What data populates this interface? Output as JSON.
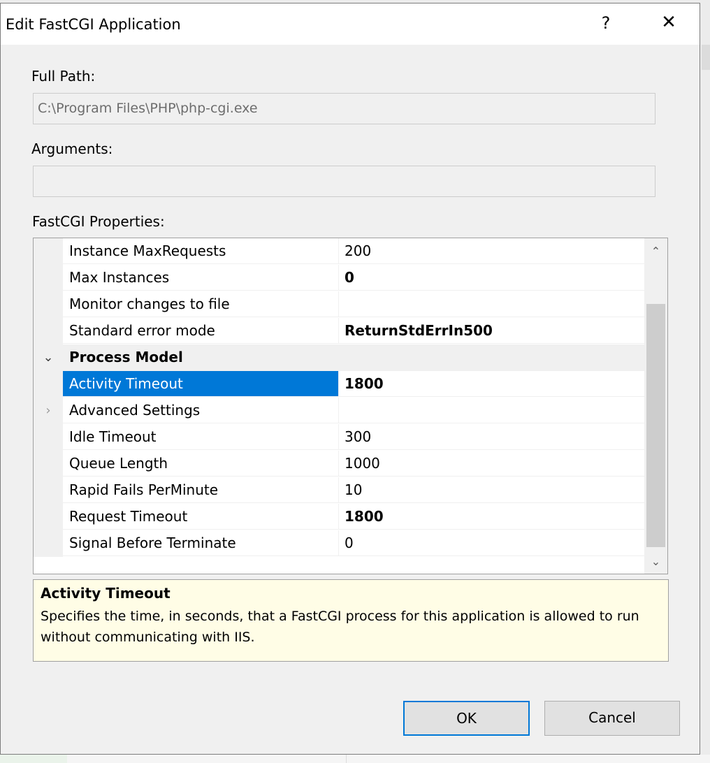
{
  "window": {
    "title": "Edit FastCGI Application",
    "help_glyph": "?",
    "close_glyph": "✕"
  },
  "full_path": {
    "label": "Full Path:",
    "value": "C:\\Program Files\\PHP\\php-cgi.exe"
  },
  "arguments": {
    "label": "Arguments:",
    "value": ""
  },
  "properties": {
    "label": "FastCGI Properties:",
    "rows": [
      {
        "name": "Instance MaxRequests",
        "value": "200",
        "bold": false
      },
      {
        "name": "Max Instances",
        "value": "0",
        "bold": true
      },
      {
        "name": "Monitor changes to file",
        "value": "",
        "bold": false
      },
      {
        "name": "Standard error mode",
        "value": "ReturnStdErrIn500",
        "bold": true
      },
      {
        "name": "Process Model",
        "category": true,
        "expanded": true
      },
      {
        "name": "Activity Timeout",
        "value": "1800",
        "bold": true,
        "selected": true
      },
      {
        "name": "Advanced Settings",
        "value": "",
        "bold": false,
        "expandable": true
      },
      {
        "name": "Idle Timeout",
        "value": "300",
        "bold": false
      },
      {
        "name": "Queue Length",
        "value": "1000",
        "bold": false
      },
      {
        "name": "Rapid Fails PerMinute",
        "value": "10",
        "bold": false
      },
      {
        "name": "Request Timeout",
        "value": "1800",
        "bold": true
      },
      {
        "name": "Signal Before Terminate",
        "value": "0",
        "bold": false
      }
    ],
    "expanded_glyph": "⌄",
    "collapsed_glyph": "›",
    "scroll_up_glyph": "⌃",
    "scroll_down_glyph": "⌄"
  },
  "description": {
    "title": "Activity Timeout",
    "text": "Specifies the time, in seconds, that a FastCGI process for this application is allowed to run without communicating with IIS."
  },
  "buttons": {
    "ok": "OK",
    "cancel": "Cancel"
  },
  "colors": {
    "selection": "#0078d7",
    "description_bg": "#fffde6"
  }
}
